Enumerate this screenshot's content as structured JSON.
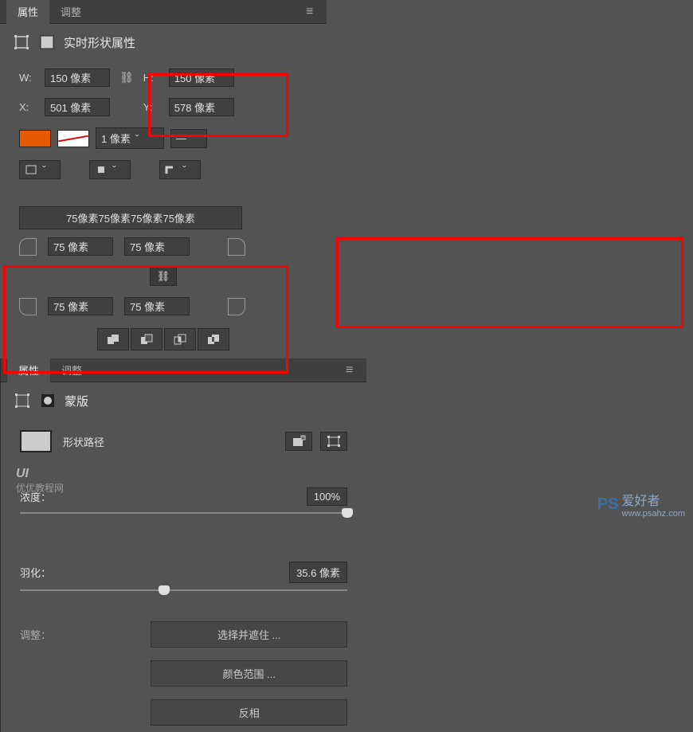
{
  "tabs": {
    "properties": "属性",
    "adjustments": "调整"
  },
  "left": {
    "title": "实时形状属性",
    "w_label": "W:",
    "w_value": "150 像素",
    "h_label": "H:",
    "h_value": "150 像素",
    "x_label": "X:",
    "x_value": "501 像素",
    "y_label": "Y:",
    "y_value": "578 像素",
    "stroke_width": "1 像素",
    "radius_all": "75像素75像素75像素75像素",
    "r_tl": "75 像素",
    "r_tr": "75 像素",
    "r_bl": "75 像素",
    "r_br": "75 像素"
  },
  "right": {
    "title": "蒙版",
    "shape_path": "形状路径",
    "density_label": "浓度：",
    "density_value": "100%",
    "feather_label": "羽化：",
    "feather_value": "35.6 像素",
    "refine_label": "调整：",
    "btn_select": "选择并遮住 ...",
    "btn_color_range": "颜色范围 ...",
    "btn_invert": "反相"
  },
  "watermarks": {
    "left_logo": "UI",
    "left_text": "优优教程网",
    "right_text": "爱好者",
    "right_url": "www.psahz.com"
  }
}
